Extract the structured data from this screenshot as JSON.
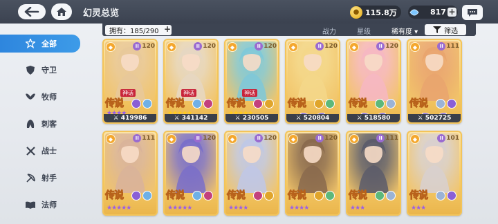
{
  "header": {
    "title": "幻灵总览",
    "gold": "115.8万",
    "gems": "817"
  },
  "sidebar": {
    "items": [
      {
        "label": "全部",
        "icon": "star-burst-icon",
        "active": true
      },
      {
        "label": "守卫",
        "icon": "shield-icon",
        "active": false
      },
      {
        "label": "牧师",
        "icon": "wings-icon",
        "active": false
      },
      {
        "label": "刺客",
        "icon": "hood-icon",
        "active": false
      },
      {
        "label": "战士",
        "icon": "crossed-swords-icon",
        "active": false
      },
      {
        "label": "射手",
        "icon": "bow-icon",
        "active": false
      },
      {
        "label": "法师",
        "icon": "book-icon",
        "active": false
      }
    ]
  },
  "filterbar": {
    "owned": "拥有：185/290",
    "sort_power": "战力",
    "sort_star": "星级",
    "sort_rarity": "稀有度 ▾",
    "filter": "筛选"
  },
  "cards": [
    {
      "level": "120",
      "myth": "神话",
      "rarity": "传说",
      "stars": "★★★★",
      "power": "419986",
      "tone": "#e8c89a"
    },
    {
      "level": "120",
      "myth": "神话",
      "rarity": "传说",
      "stars": "★★★★★",
      "power": "341142",
      "tone": "#e6d7c2"
    },
    {
      "level": "120",
      "myth": "神话",
      "rarity": "传说",
      "stars": "★★★★★",
      "power": "230505",
      "tone": "#7fc8d8"
    },
    {
      "level": "120",
      "myth": "",
      "rarity": "传说",
      "stars": "",
      "power": "520804",
      "tone": "#f3d78a"
    },
    {
      "level": "120",
      "myth": "",
      "rarity": "传说",
      "stars": "",
      "power": "518580",
      "tone": "#f6b7c2"
    },
    {
      "level": "111",
      "myth": "",
      "rarity": "传说",
      "stars": "",
      "power": "502725",
      "tone": "#e9a46e"
    },
    {
      "level": "111",
      "myth": "",
      "rarity": "传说",
      "stars": "★★★★★",
      "power": "",
      "tone": "#d9b39a"
    },
    {
      "level": "120",
      "myth": "",
      "rarity": "传说",
      "stars": "★★★★★",
      "power": "",
      "tone": "#7a6fc9"
    },
    {
      "level": "120",
      "myth": "",
      "rarity": "传说",
      "stars": "★★★★",
      "power": "",
      "tone": "#bfc7e6"
    },
    {
      "level": "120",
      "myth": "",
      "rarity": "传说",
      "stars": "★★★★",
      "power": "",
      "tone": "#8a6a4e"
    },
    {
      "level": "111",
      "myth": "",
      "rarity": "传说",
      "stars": "★★★",
      "power": "",
      "tone": "#5c5c6a"
    },
    {
      "level": "101",
      "myth": "",
      "rarity": "传说",
      "stars": "★★★",
      "power": "",
      "tone": "#d8d0cf"
    }
  ]
}
